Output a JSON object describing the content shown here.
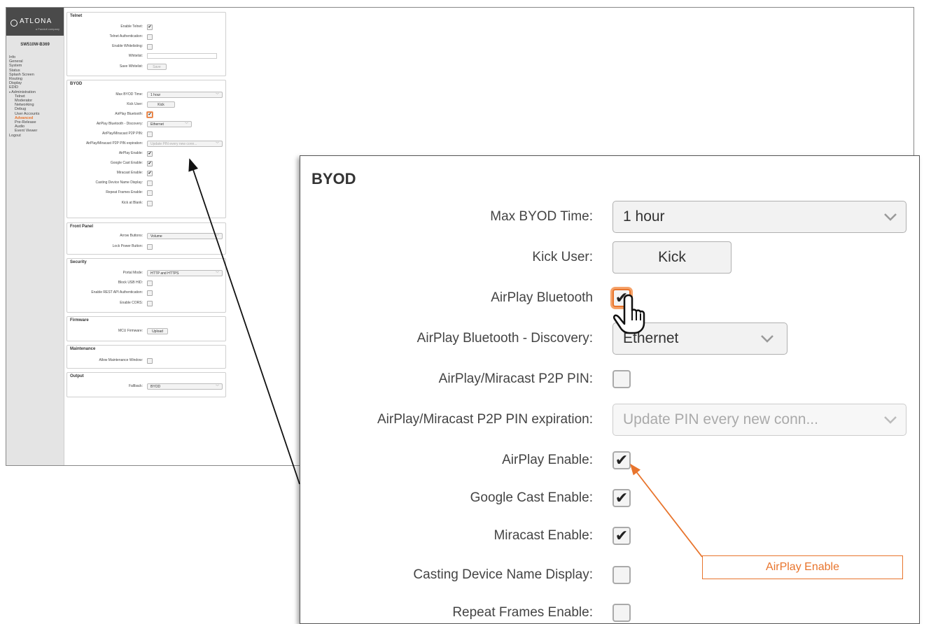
{
  "sidebar": {
    "brand": "ATLONA",
    "brand_sub": "a Panduit company",
    "model": "SW510W-B369",
    "nav": [
      {
        "label": "Info",
        "level": 0,
        "active": false
      },
      {
        "label": "General",
        "level": 0,
        "active": false
      },
      {
        "label": "System",
        "level": 0,
        "active": false
      },
      {
        "label": "Status",
        "level": 0,
        "active": false
      },
      {
        "label": "Splash Screen",
        "level": 0,
        "active": false
      },
      {
        "label": "Routing",
        "level": 0,
        "active": false
      },
      {
        "label": "Display",
        "level": 0,
        "active": false
      },
      {
        "label": "EDID",
        "level": 0,
        "active": false
      },
      {
        "label": "Administration",
        "level": 0,
        "active": false,
        "expanded": true
      },
      {
        "label": "Telnet",
        "level": 1,
        "active": false
      },
      {
        "label": "Moderator",
        "level": 1,
        "active": false
      },
      {
        "label": "Networking",
        "level": 1,
        "active": false
      },
      {
        "label": "Debug",
        "level": 1,
        "active": false
      },
      {
        "label": "User Accounts",
        "level": 1,
        "active": false
      },
      {
        "label": "Advanced",
        "level": 1,
        "active": true
      },
      {
        "label": "Pre-Release",
        "level": 1,
        "active": false
      },
      {
        "label": "Audio",
        "level": 1,
        "active": false
      },
      {
        "label": "Event Viewer",
        "level": 1,
        "active": false
      },
      {
        "label": "Logout",
        "level": 0,
        "active": false
      }
    ]
  },
  "telnet": {
    "title": "Telnet",
    "enable_telnet": "Enable Telnet:",
    "telnet_auth": "Telnet Authentication:",
    "enable_whitelisting": "Enable Whitelisting:",
    "whitelist": "Whitelist:",
    "save_whitelist": "Save Whitelist:",
    "save_button": "Save"
  },
  "byod": {
    "title": "BYOD",
    "max_time_label": "Max BYOD Time:",
    "max_time_value": "1 hour",
    "kick_user_label": "Kick User:",
    "kick_button": "Kick",
    "airplay_bt_label": "AirPlay Bluetooth:",
    "airplay_bt_label_zoom": "AirPlay Bluetooth",
    "discovery_label": "AirPlay Bluetooth - Discovery:",
    "discovery_value": "Ethernet",
    "p2p_pin_label": "AirPlay/Miracast P2P PIN:",
    "pin_exp_label": "AirPlay/Miracast P2P PIN expiration:",
    "pin_exp_value_small": "Update PIN every new conn...",
    "pin_exp_value": "Update PIN every new conn...",
    "airplay_enable_label": "AirPlay Enable:",
    "google_cast_label": "Google Cast Enable:",
    "miracast_label": "Miracast Enable:",
    "casting_name_label": "Casting Device Name Display:",
    "repeat_frames_label": "Repeat Frames Enable:",
    "kick_blank_label": "Kick at Blank:"
  },
  "front_panel": {
    "title": "Front Panel",
    "arrow_buttons_label": "Arrow Buttons:",
    "arrow_buttons_value": "Volume",
    "lock_power_label": "Lock Power Button:"
  },
  "security": {
    "title": "Security",
    "portal_mode_label": "Portal Mode:",
    "portal_mode_value": "HTTP and HTTPS",
    "block_usb_label": "Block USB HID:",
    "rest_api_label": "Enable REST API Authentication:",
    "cors_label": "Enable CORS:"
  },
  "firmware": {
    "title": "Firmware",
    "mcu_label": "MCU Firmware:",
    "upload_button": "Upload"
  },
  "maintenance": {
    "title": "Maintenance",
    "window_label": "Allow Maintenance Window:"
  },
  "output": {
    "title": "Output",
    "fallback_label": "Fallback:",
    "fallback_value": "BYOD"
  },
  "checks": {
    "check_glyph": "✔",
    "enable_telnet": true,
    "airplay_bt": true,
    "airplay_enable": true,
    "google_cast": true,
    "miracast": true
  },
  "callout": {
    "label": "AirPlay Enable",
    "color": "#e8742c"
  },
  "colors": {
    "accent": "#e8742c",
    "sidebar_bg": "#e4e4e4",
    "logo_bg": "#4a4a4a"
  }
}
